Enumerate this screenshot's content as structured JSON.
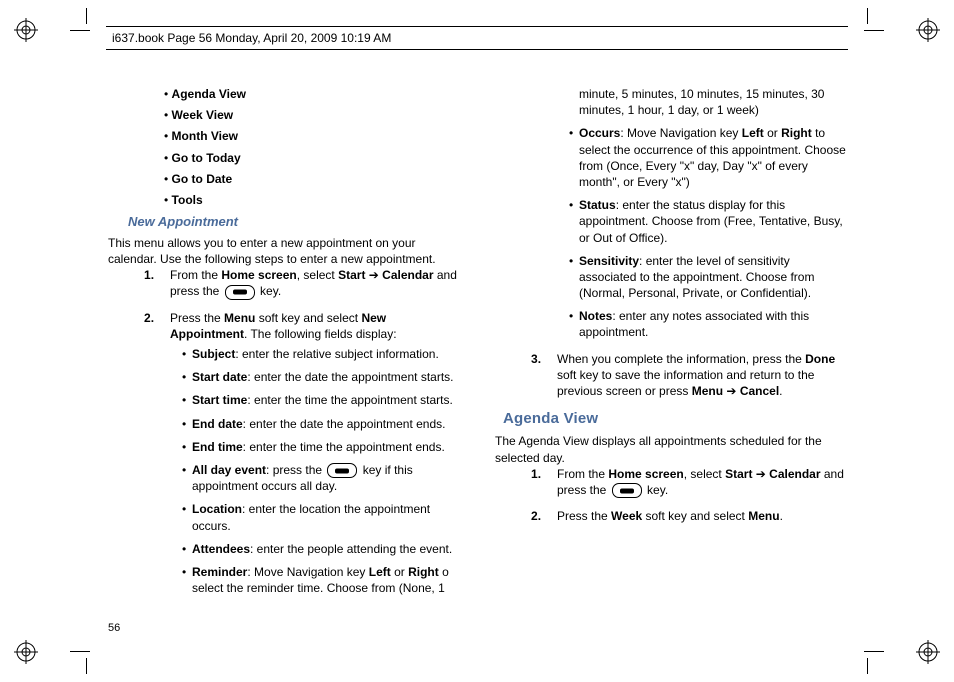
{
  "header": {
    "running": "i637.book  Page 56  Monday, April 20, 2009  10:19 AM"
  },
  "page_number": "56",
  "col1": {
    "menu": [
      "Agenda View",
      "Week View",
      "Month View",
      "Go to Today",
      "Go to Date",
      "Tools"
    ],
    "new_appt_heading": "New Appointment",
    "new_appt_intro": "This menu allows you to enter a new appointment on your calendar. Use the following steps to enter a new appointment.",
    "step1": {
      "pre": "From the ",
      "b1": "Home screen",
      "mid1": ", select ",
      "b2": "Start",
      "arrow": " ➔ ",
      "b3": "Calendar",
      "mid2": " and press the ",
      "post": " key."
    },
    "step2": {
      "pre": "Press the ",
      "b1": "Menu",
      "mid1": " soft key and select ",
      "b2": "New Appointment",
      "post": ". The following fields display:"
    },
    "fields": {
      "subject": {
        "label": "Subject",
        "rest": ": enter the relative subject information."
      },
      "startdate": {
        "label": "Start date",
        "rest": ": enter the date the appointment starts."
      },
      "starttime": {
        "label": "Start time",
        "rest": ": enter the time the appointment starts."
      },
      "enddate": {
        "label": "End date",
        "rest": ": enter the date the appointment ends."
      },
      "endtime": {
        "label": "End time",
        "rest": ": enter the time the appointment ends."
      },
      "allday": {
        "label": "All day event",
        "pre": ": press the ",
        "post": " key if this appointment occurs all day."
      },
      "location": {
        "label": "Location",
        "rest": ": enter the location the appointment occurs."
      }
    }
  },
  "col2": {
    "fields": {
      "attendees": {
        "label": "Attendees",
        "rest": ": enter the people attending the event."
      },
      "reminder": {
        "label": "Reminder",
        "pre": ": Move Navigation key ",
        "b1": "Left",
        "mid": " or ",
        "b2": "Right",
        "post": " o select the reminder time. Choose from (None, 1 minute, 5 minutes, 10 minutes, 15 minutes, 30 minutes, 1 hour, 1 day, or 1 week)"
      },
      "occurs": {
        "label": "Occurs",
        "pre": ": Move Navigation key ",
        "b1": "Left",
        "mid": " or ",
        "b2": "Right",
        "post": " to select the occurrence of this appointment. Choose from (Once, Every \"x\" day, Day \"x\" of every month\", or Every \"x\")"
      },
      "status": {
        "label": "Status",
        "rest": ": enter the status display for this appointment. Choose from (Free, Tentative, Busy, or Out of Office)."
      },
      "sensitivity": {
        "label": "Sensitivity",
        "rest": ": enter the level of sensitivity associated to the appointment. Choose from (Normal, Personal, Private, or Confidential)."
      },
      "notes": {
        "label": "Notes",
        "rest": ": enter any notes associated with this appointment."
      }
    },
    "step3": {
      "pre": "When you complete the information, press the ",
      "b1": "Done",
      "mid1": " soft key to save the information and return to the previous screen or press ",
      "b2": "Menu",
      "arrow": " ➔ ",
      "b3": "Cancel",
      "post": "."
    },
    "agenda_heading": "Agenda View",
    "agenda_intro": "The Agenda View displays all appointments scheduled for the selected day.",
    "astep1": {
      "pre": "From the ",
      "b1": "Home screen",
      "mid1": ", select ",
      "b2": "Start",
      "arrow": " ➔ ",
      "b3": "Calendar",
      "mid2": " and press the ",
      "post": " key."
    },
    "astep2": {
      "pre": "Press the ",
      "b1": "Week",
      "mid": " soft key and select ",
      "b2": "Menu",
      "post": "."
    }
  }
}
